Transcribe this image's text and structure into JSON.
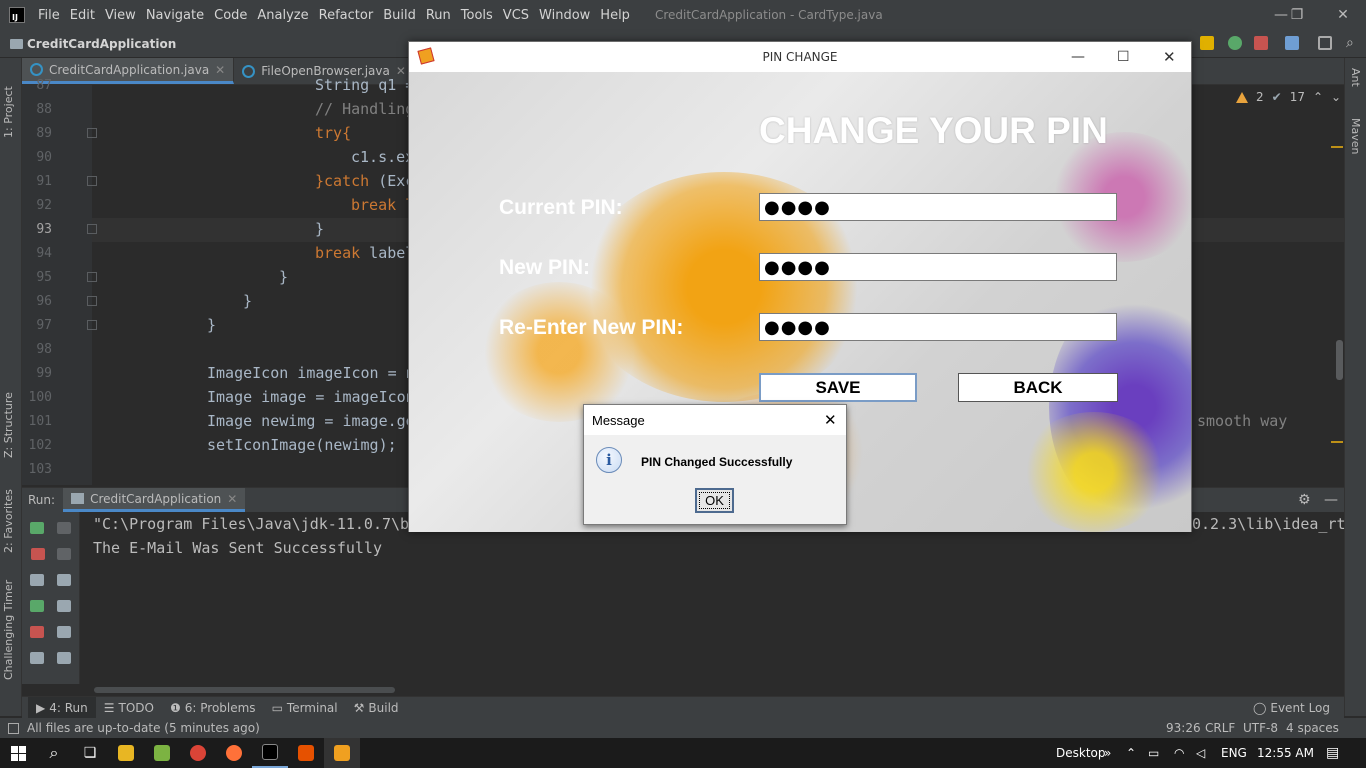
{
  "menubar": {
    "items": [
      "File",
      "Edit",
      "View",
      "Navigate",
      "Code",
      "Analyze",
      "Refactor",
      "Build",
      "Run",
      "Tools",
      "VCS",
      "Window",
      "Help"
    ],
    "window_title": "CreditCardApplication - CardType.java",
    "minimize": "—",
    "restore": "❐",
    "close": "✕"
  },
  "navbar": {
    "project": "CreditCardApplication"
  },
  "tabs": [
    {
      "label": "CreditCardApplication.java"
    },
    {
      "label": "FileOpenBrowser.java"
    }
  ],
  "left_stripe": {
    "project": "1: Project",
    "structure": "Z: Structure",
    "favorites": "2: Favorites",
    "timer": "Challenging Timer"
  },
  "right_stripe": {
    "ant": "Ant",
    "maven": "Maven"
  },
  "inspections": {
    "warnings": "2",
    "weak_warnings": "17"
  },
  "editor": {
    "lines": [
      {
        "n": "87",
        "code": "String q1 ="
      },
      {
        "n": "88",
        "code": "// Handling"
      },
      {
        "n": "89",
        "code": "try{"
      },
      {
        "n": "90",
        "code": "c1.s.ex"
      },
      {
        "n": "91",
        "code_kw": "}catch",
        "code_rest": " (Exc"
      },
      {
        "n": "92",
        "code": "break l"
      },
      {
        "n": "93",
        "code": "}"
      },
      {
        "n": "94",
        "code_kw": "break",
        "code_rest": " label"
      },
      {
        "n": "95",
        "code": "}"
      },
      {
        "n": "96",
        "code": "}"
      },
      {
        "n": "97",
        "code": "}"
      },
      {
        "n": "98",
        "code": ""
      },
      {
        "n": "99",
        "code": "ImageIcon imageIcon = n"
      },
      {
        "n": "100",
        "code": "Image image = imageIcon"
      },
      {
        "n": "101",
        "code": "Image newimg = image.ge"
      },
      {
        "n": "102",
        "code": "setIconImage(newimg);"
      },
      {
        "n": "103",
        "code": ""
      }
    ],
    "overflow_text": "smooth way"
  },
  "run_panel": {
    "label": "Run:",
    "config": "CreditCardApplication",
    "console": [
      "\"C:\\Program Files\\Java\\jdk-11.0.7\\b",
      "The E-Mail Was Sent Successfully"
    ],
    "console_tail": "0.2.3\\lib\\idea_rt"
  },
  "bottom_tabs": [
    "4: Run",
    "TODO",
    "6: Problems",
    "Terminal",
    "Build"
  ],
  "event_log": "Event Log",
  "status": {
    "message": "All files are up-to-date (5 minutes ago)",
    "position": "93:26",
    "line_sep": "CRLF",
    "encoding": "UTF-8",
    "indent": "4 spaces"
  },
  "pin_window": {
    "title": "PIN CHANGE",
    "heading": "CHANGE YOUR PIN",
    "labels": {
      "current": "Current PIN:",
      "new": "New PIN:",
      "reenter": "Re-Enter New PIN:"
    },
    "values": {
      "current": "●●●●",
      "new": "●●●●",
      "reenter": "●●●●"
    },
    "save": "SAVE",
    "back": "BACK"
  },
  "message_dialog": {
    "title": "Message",
    "text": "PIN Changed Successfully",
    "ok": "OK",
    "icon_glyph": "i"
  },
  "taskbar": {
    "desktop": "Desktop",
    "chevron": "»",
    "lang": "ENG",
    "time": "12:55 AM"
  },
  "colors": {
    "accent": "#4a88c7",
    "warning": "#e8a33d",
    "keyword": "#cc7832"
  }
}
